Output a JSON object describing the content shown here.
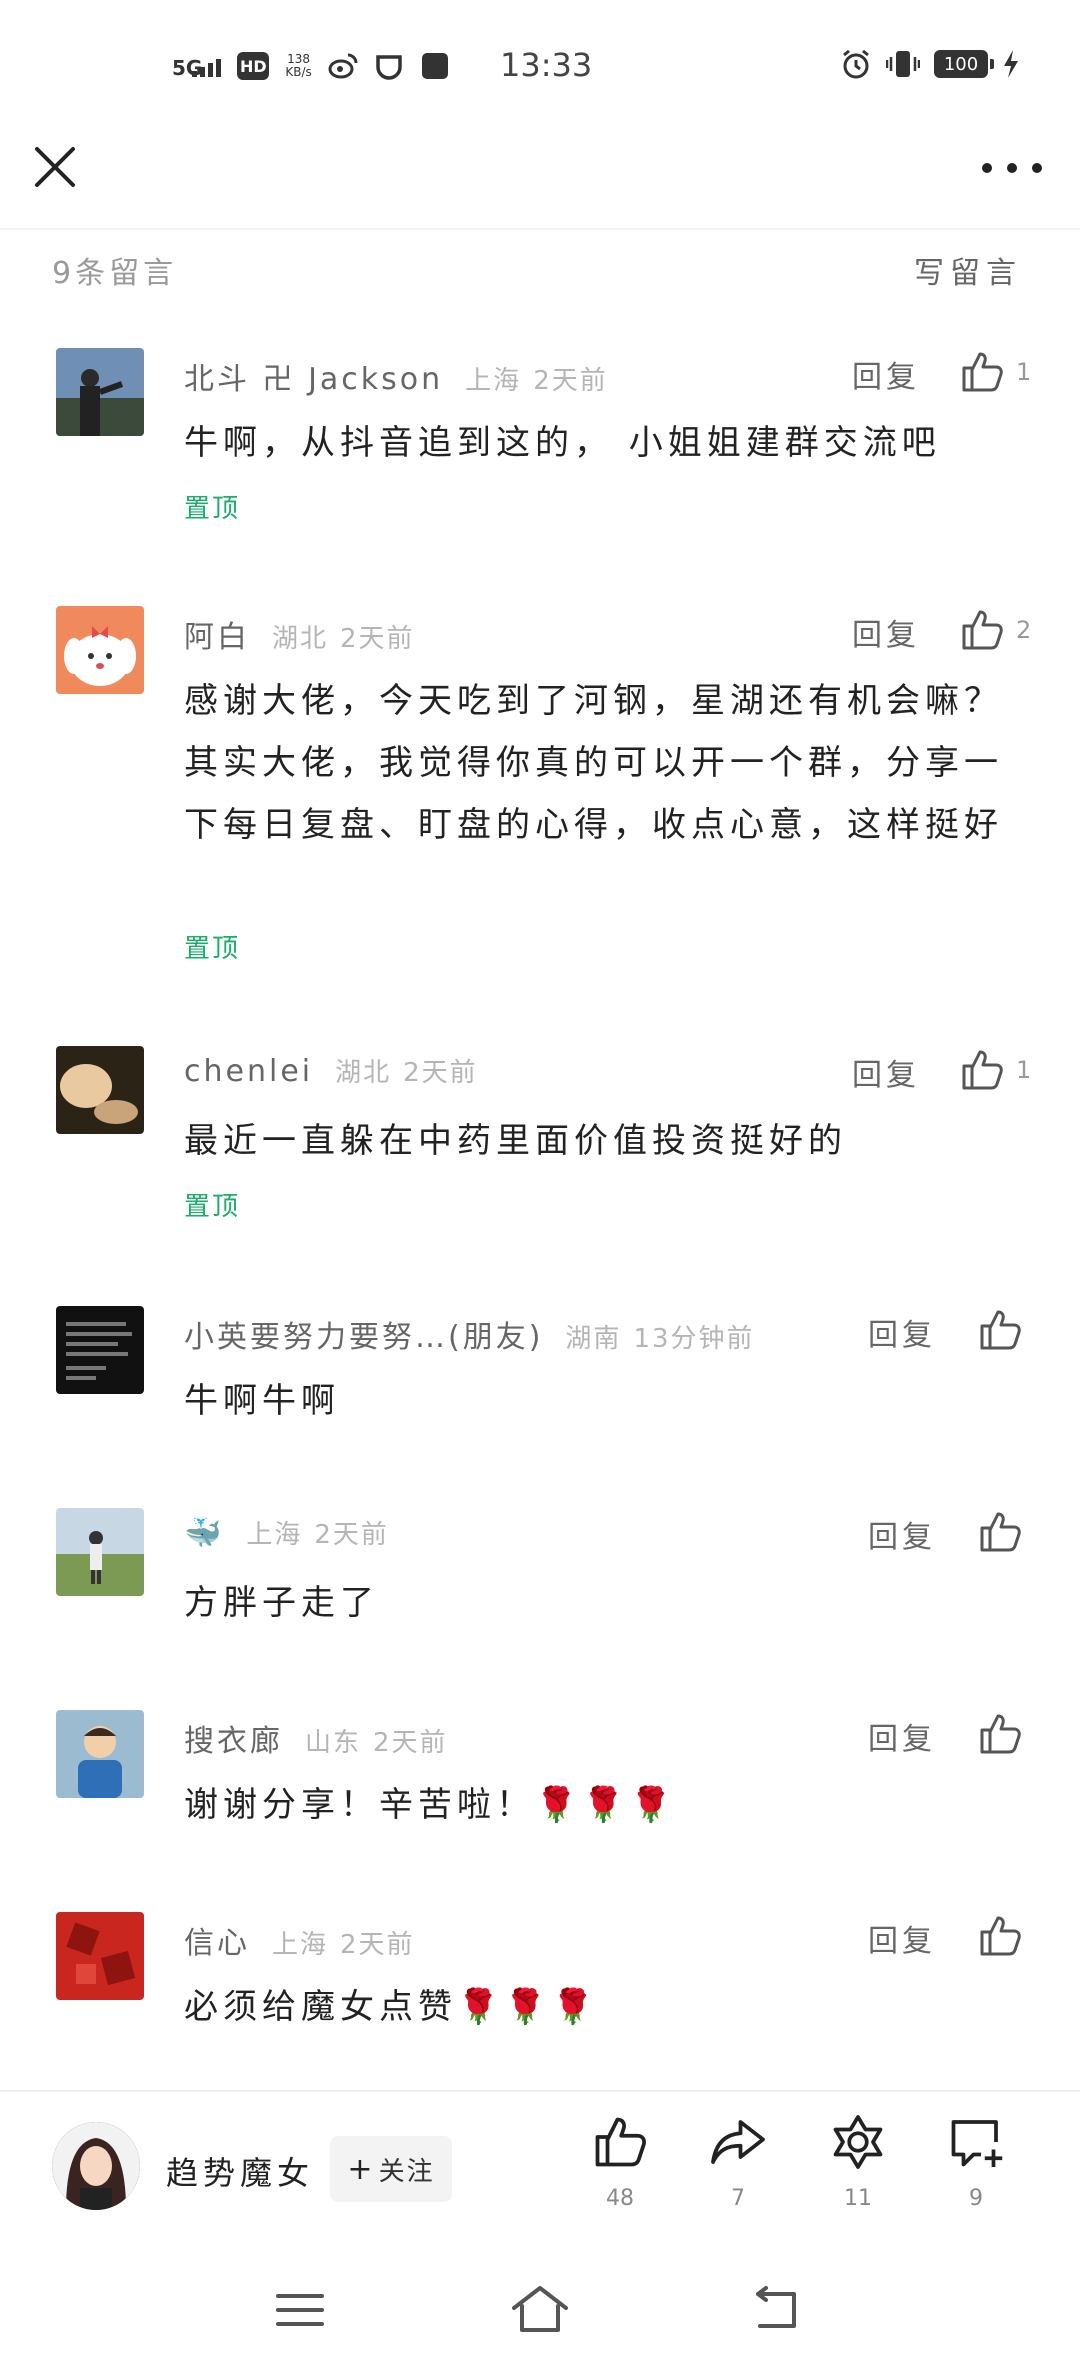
{
  "status": {
    "network": "5G",
    "hd": "HD",
    "speed_value": "138",
    "speed_unit": "KB/s",
    "time": "13:33",
    "battery": "100"
  },
  "comments_header": {
    "count_text": "9条留言",
    "write_label": "写留言"
  },
  "comments": [
    {
      "name": "北斗 卍 Jackson",
      "location": "上海",
      "time": "2天前",
      "text": "牛啊，从抖音追到这的， 小姐姐建群交流吧",
      "reply": "回复",
      "likes": "1",
      "pinned": "置顶"
    },
    {
      "name": "阿白",
      "location": "湖北",
      "time": "2天前",
      "text": "感谢大佬，今天吃到了河钢，星湖还有机会嘛？其实大佬，我觉得你真的可以开一个群，分享一下每日复盘、盯盘的心得，收点心意，这样挺好",
      "reply": "回复",
      "likes": "2",
      "pinned": "置顶"
    },
    {
      "name": "chenlei",
      "location": "湖北",
      "time": "2天前",
      "text": "最近一直躲在中药里面价值投资挺好的",
      "reply": "回复",
      "likes": "1",
      "pinned": "置顶"
    },
    {
      "name": "小英要努力要努…(朋友)",
      "location": "湖南",
      "time": "13分钟前",
      "text": "牛啊牛啊",
      "reply": "回复",
      "likes": "",
      "pinned": ""
    },
    {
      "name": "🐳",
      "location": "上海",
      "time": "2天前",
      "text": "方胖子走了",
      "reply": "回复",
      "likes": "",
      "pinned": ""
    },
    {
      "name": "搜衣廊",
      "location": "山东",
      "time": "2天前",
      "text": "谢谢分享！辛苦啦！🌹🌹🌹",
      "reply": "回复",
      "likes": "",
      "pinned": ""
    },
    {
      "name": "信心",
      "location": "上海",
      "time": "2天前",
      "text": "必须给魔女点赞🌹🌹🌹",
      "reply": "回复",
      "likes": "",
      "pinned": ""
    }
  ],
  "author": {
    "name": "趋势魔女",
    "follow_plus": "+",
    "follow_label": "关注"
  },
  "actions": {
    "like_count": "48",
    "share_count": "7",
    "star_count": "11",
    "comment_count": "9"
  },
  "colors": {
    "pinned": "#1aad6b",
    "text": "#222222",
    "muted": "#9a9a9a"
  }
}
